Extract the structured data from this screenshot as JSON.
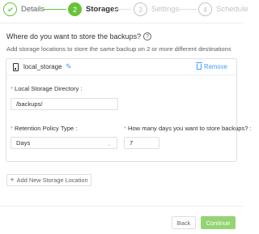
{
  "stepper": {
    "steps": [
      {
        "number": "",
        "label": "Details",
        "state": "done"
      },
      {
        "number": "2",
        "label": "Storages",
        "state": "active"
      },
      {
        "number": "3",
        "label": "Settings",
        "state": "todo"
      },
      {
        "number": "4",
        "label": "Schedule",
        "state": "todo"
      }
    ],
    "done_icon": "check-icon"
  },
  "section": {
    "title": "Where do you want to store the backups?",
    "help_icon": "question-circle-icon",
    "subtitle": "Add storage locations to store the same backup on 2 or more different destinations"
  },
  "storage": {
    "name": "local_storage",
    "storage_icon": "storage-device-icon",
    "edit_icon": "pencil-icon",
    "remove_label": "Remove",
    "remove_icon": "trash-icon",
    "directory_label": "Local Storage Directory :",
    "directory_value": "/backups/",
    "retention_label": "Retention Policy Type :",
    "retention_value": "Days",
    "days_label": "How many days you want to store backups? :",
    "days_value": "7"
  },
  "add_storage_label": "Add New Storage Location",
  "footer": {
    "back_label": "Back",
    "continue_label": "Continue"
  },
  "colors": {
    "accent_green": "#67c23a",
    "continue_disabled": "#95d475",
    "link_blue": "#409eff",
    "required_red": "#f56c6c"
  }
}
